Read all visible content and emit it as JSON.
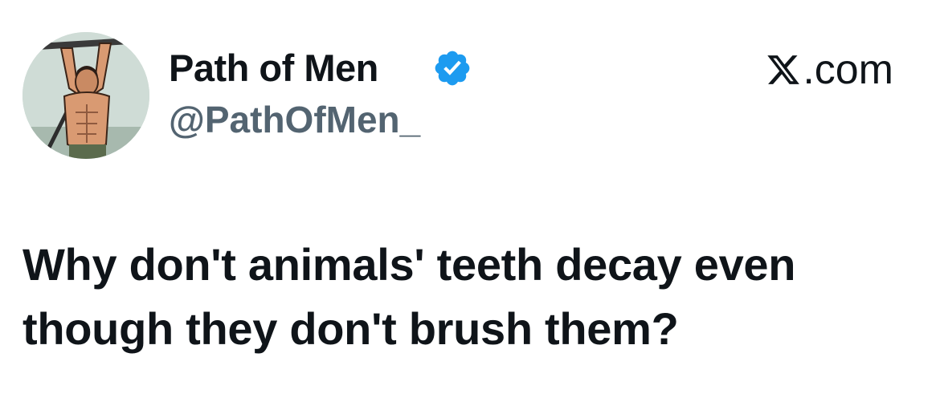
{
  "author": {
    "display_name": "Path of Men",
    "handle": "@PathOfMen_",
    "verified_icon": "verified-badge-icon",
    "avatar_icon": "avatar-comic-man-illustration"
  },
  "source": {
    "logo_icon": "x-logo-icon",
    "label": ".com"
  },
  "tweet": {
    "text": "Why don't animals' teeth decay even though they don't brush them?"
  },
  "colors": {
    "text": "#0f1419",
    "handle": "#536471",
    "verified": "#1d9bf0",
    "background": "#ffffff"
  }
}
